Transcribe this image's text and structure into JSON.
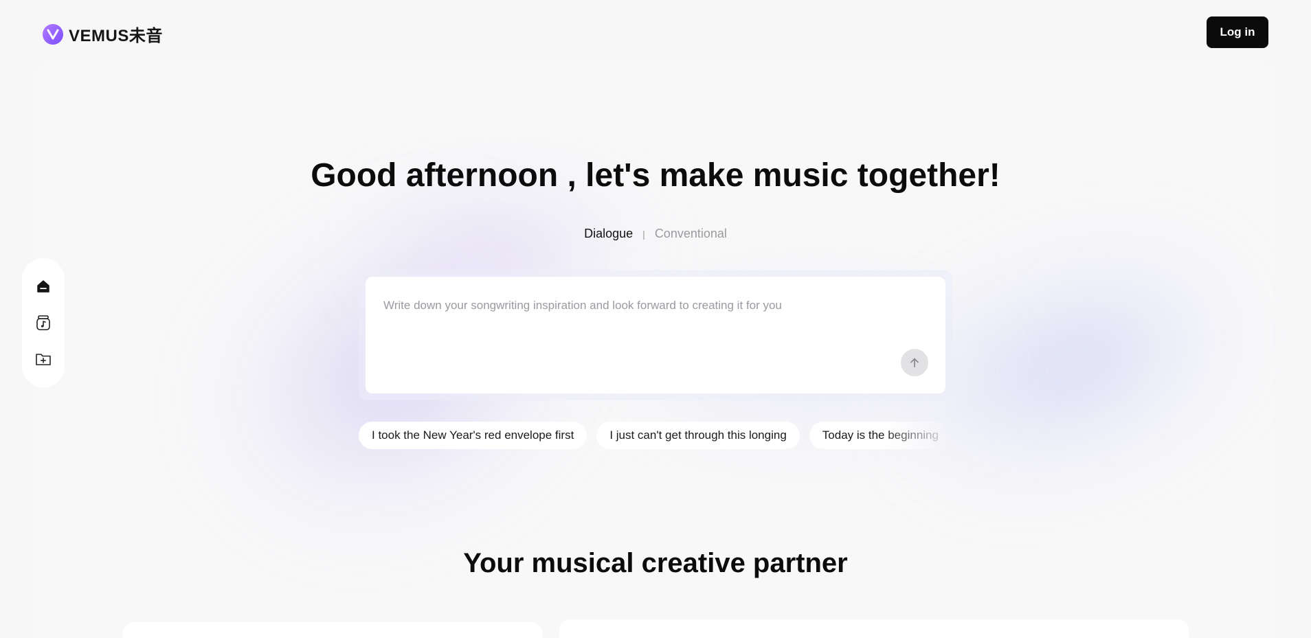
{
  "header": {
    "logo_text": "VEMUS未音",
    "login_label": "Log in"
  },
  "sidebar": {
    "items": [
      {
        "icon": "home-icon",
        "active": true
      },
      {
        "icon": "music-jar-icon",
        "active": false
      },
      {
        "icon": "folder-add-icon",
        "active": false
      }
    ]
  },
  "hero": {
    "title": "Good afternoon , let's make music together!",
    "modes": {
      "active": "Dialogue",
      "separator": "|",
      "inactive": "Conventional"
    },
    "input": {
      "placeholder": "Write down your songwriting inspiration and look forward to creating it for you",
      "value": ""
    },
    "suggestions": [
      "I took the New Year's red envelope first",
      "I just can't get through this longing",
      "Today is the beginning"
    ]
  },
  "section": {
    "title": "Your musical creative partner"
  },
  "colors": {
    "accent": "#7a4dff",
    "button_dark": "#0b0b0c",
    "background": "#f7f7f8"
  }
}
